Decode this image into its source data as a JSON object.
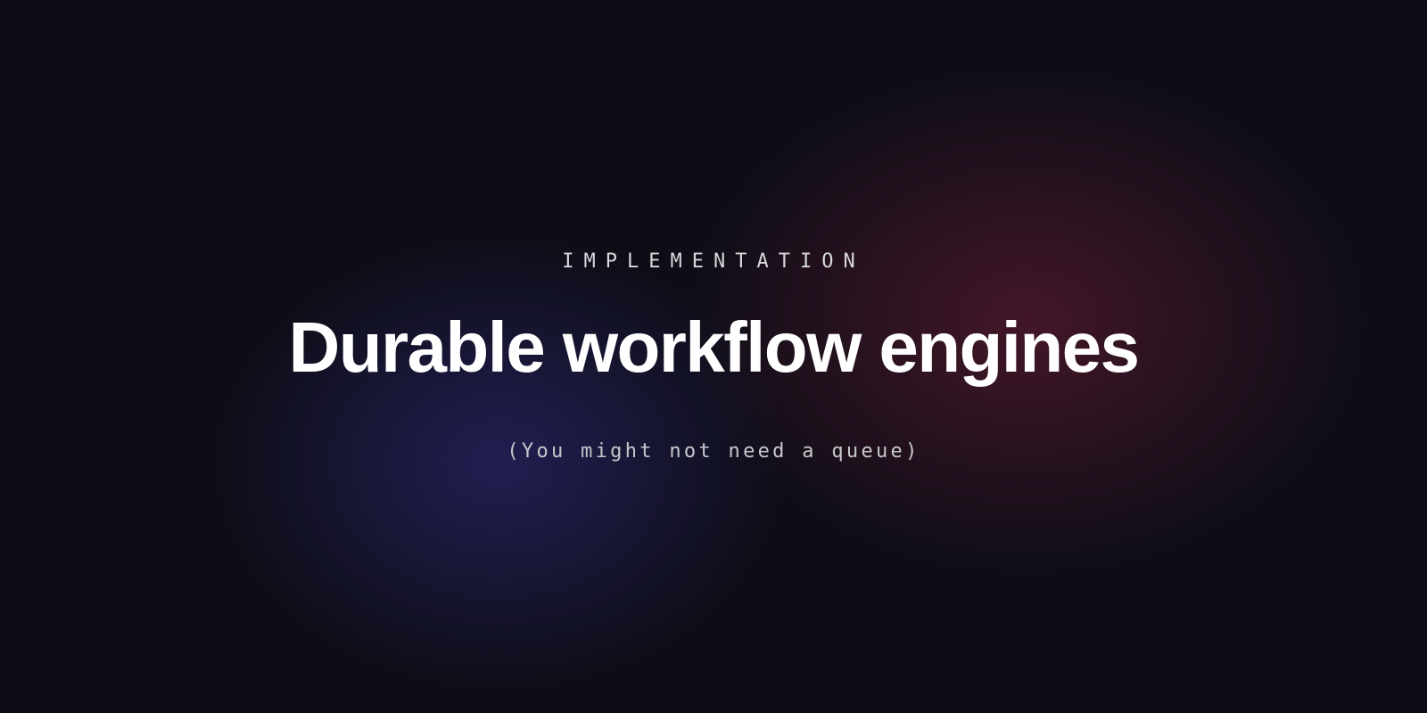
{
  "hero": {
    "eyebrow": "IMPLEMENTATION",
    "title": "Durable workflow engines",
    "subtitle": "(You might not need a queue)"
  }
}
